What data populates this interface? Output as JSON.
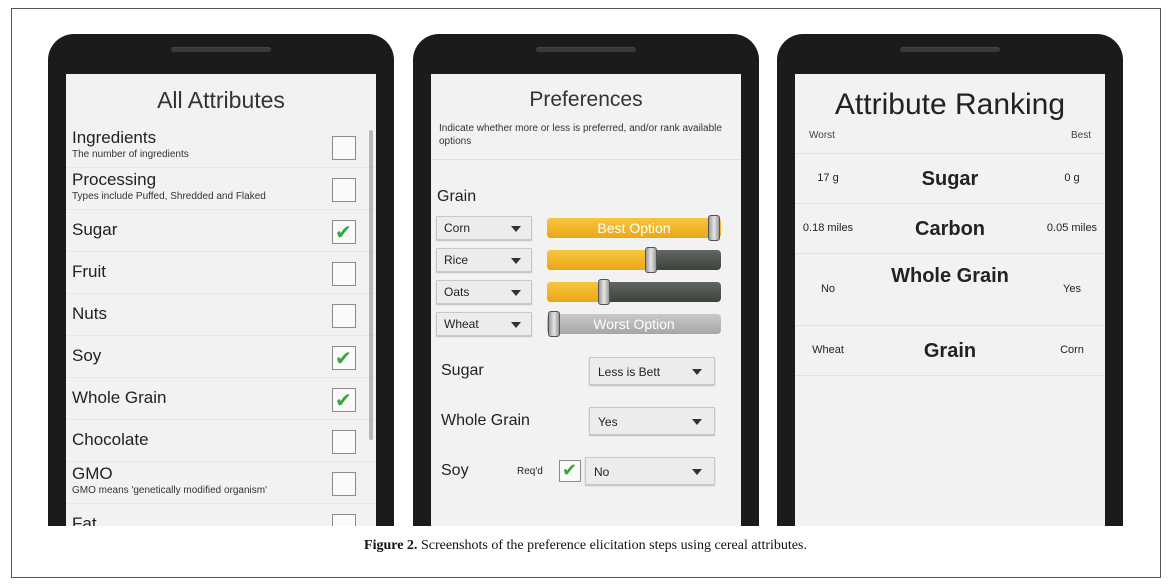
{
  "screen1": {
    "title": "All Attributes",
    "items": [
      {
        "name": "Ingredients",
        "desc": "The number of ingredients",
        "checked": false
      },
      {
        "name": "Processing",
        "desc": "Types include Puffed, Shredded and Flaked",
        "checked": false
      },
      {
        "name": "Sugar",
        "desc": "",
        "checked": true
      },
      {
        "name": "Fruit",
        "desc": "",
        "checked": false
      },
      {
        "name": "Nuts",
        "desc": "",
        "checked": false
      },
      {
        "name": "Soy",
        "desc": "",
        "checked": true
      },
      {
        "name": "Whole Grain",
        "desc": "",
        "checked": true
      },
      {
        "name": "Chocolate",
        "desc": "",
        "checked": false
      },
      {
        "name": "GMO",
        "desc": "GMO means 'genetically modified organism'",
        "checked": false
      },
      {
        "name": "Fat",
        "desc": "",
        "checked": false
      }
    ]
  },
  "screen2": {
    "title": "Preferences",
    "instructions": "Indicate whether more or less is preferred, and/or rank available options",
    "grain_label": "Grain",
    "grain_options": [
      {
        "name": "Corn",
        "level": 1.0,
        "label": "Best Option"
      },
      {
        "name": "Rice",
        "level": 0.6,
        "label": ""
      },
      {
        "name": "Oats",
        "level": 0.33,
        "label": ""
      },
      {
        "name": "Wheat",
        "level": 0.0,
        "label": "Worst Option"
      }
    ],
    "prefs": [
      {
        "name": "Sugar",
        "value": "Less is Bett"
      },
      {
        "name": "Whole Grain",
        "value": "Yes"
      },
      {
        "name": "Soy",
        "value": "No",
        "reqd_label": "Req'd",
        "reqd_checked": true
      }
    ]
  },
  "screen3": {
    "title": "Attribute Ranking",
    "worst_label": "Worst",
    "best_label": "Best",
    "rows": [
      {
        "worst": "17 g",
        "attribute": "Sugar",
        "best": "0 g"
      },
      {
        "worst": "0.18 miles",
        "attribute": "Carbon",
        "best": "0.05 miles"
      },
      {
        "worst": "No",
        "attribute": "Whole Grain",
        "best": "Yes"
      },
      {
        "worst": "Wheat",
        "attribute": "Grain",
        "best": "Corn"
      }
    ]
  },
  "caption": {
    "label": "Figure 2.",
    "text": "Screenshots of the preference elicitation steps using cereal attributes."
  },
  "colors": {
    "check": "#3aa63a",
    "slider_fill": "#eca618",
    "slider_track": "#4a4e4a",
    "phone_body": "#1b1b1b"
  }
}
